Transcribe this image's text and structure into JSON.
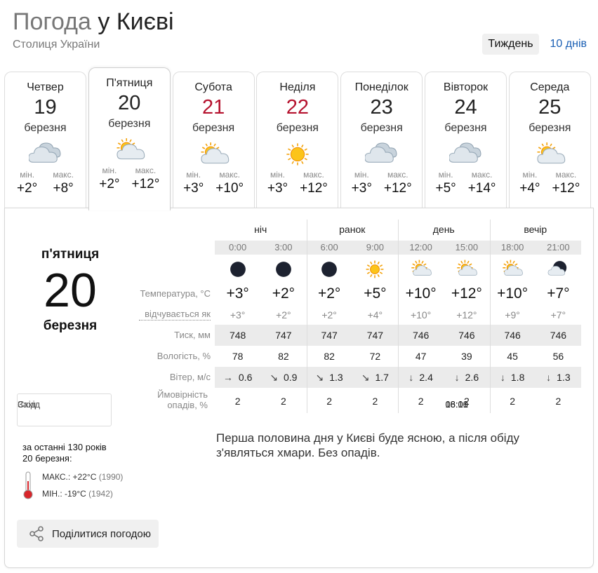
{
  "header": {
    "title_prefix": "Погода",
    "title_city": "у Києві",
    "subtitle": "Столиця України",
    "tabs": [
      {
        "label": "Тиждень",
        "active": true
      },
      {
        "label": "10 днів",
        "active": false
      }
    ]
  },
  "days": [
    {
      "name": "Четвер",
      "num": "19",
      "month": "березня",
      "weekend": false,
      "icon": "cloudy-icon",
      "min_label": "мін.",
      "max_label": "макс.",
      "min": "+2°",
      "max": "+8°"
    },
    {
      "name": "П'ятниця",
      "num": "20",
      "month": "березня",
      "weekend": false,
      "icon": "sun-cloud-icon",
      "min_label": "мін.",
      "max_label": "макс.",
      "min": "+2°",
      "max": "+12°",
      "active": true
    },
    {
      "name": "Субота",
      "num": "21",
      "month": "березня",
      "weekend": true,
      "icon": "sun-cloud-icon",
      "min_label": "мін.",
      "max_label": "макс.",
      "min": "+3°",
      "max": "+10°"
    },
    {
      "name": "Неділя",
      "num": "22",
      "month": "березня",
      "weekend": true,
      "icon": "sun-icon",
      "min_label": "мін.",
      "max_label": "макс.",
      "min": "+3°",
      "max": "+12°"
    },
    {
      "name": "Понеділок",
      "num": "23",
      "month": "березня",
      "weekend": false,
      "icon": "cloudy-icon",
      "min_label": "мін.",
      "max_label": "макс.",
      "min": "+3°",
      "max": "+12°"
    },
    {
      "name": "Вівторок",
      "num": "24",
      "month": "березня",
      "weekend": false,
      "icon": "cloudy-icon",
      "min_label": "мін.",
      "max_label": "макс.",
      "min": "+5°",
      "max": "+14°"
    },
    {
      "name": "Середа",
      "num": "25",
      "month": "березня",
      "weekend": false,
      "icon": "sun-cloud-icon",
      "min_label": "мін.",
      "max_label": "макс.",
      "min": "+4°",
      "max": "+12°"
    }
  ],
  "selected": {
    "weekday": "п'ятниця",
    "num": "20",
    "month": "березня",
    "sunrise_label": "Схід",
    "sunrise": "06:01",
    "sunset_label": "Захід",
    "sunset": "18:10"
  },
  "history": {
    "line1": "за останні 130 років",
    "line2": "20 березня:",
    "max_label": "МАКС.:",
    "max_value": "+22°C",
    "max_year": "(1990)",
    "min_label": "МІН.:",
    "min_value": "-19°C",
    "min_year": "(1942)"
  },
  "share_label": "Поділитися погодою",
  "periods": [
    "ніч",
    "ранок",
    "день",
    "вечір"
  ],
  "row_labels": {
    "temp": "Температура, °С",
    "feels": "відчувається як",
    "pressure": "Тиск, мм",
    "humidity": "Вологість, %",
    "wind": "Вітер, м/с",
    "precip": "Ймовірність опадів, %"
  },
  "hours": [
    {
      "time": "0:00",
      "icon": "moon-icon",
      "temp": "+3°",
      "feels": "+3°",
      "pressure": "748",
      "humidity": "78",
      "wind_dir": "→",
      "wind": "0.6",
      "precip": "2"
    },
    {
      "time": "3:00",
      "icon": "moon-icon",
      "temp": "+2°",
      "feels": "+2°",
      "pressure": "747",
      "humidity": "82",
      "wind_dir": "↘",
      "wind": "0.9",
      "precip": "2"
    },
    {
      "time": "6:00",
      "icon": "moon-icon",
      "temp": "+2°",
      "feels": "+2°",
      "pressure": "747",
      "humidity": "82",
      "wind_dir": "↘",
      "wind": "1.3",
      "precip": "2"
    },
    {
      "time": "9:00",
      "icon": "sun-icon",
      "temp": "+5°",
      "feels": "+4°",
      "pressure": "747",
      "humidity": "72",
      "wind_dir": "↘",
      "wind": "1.7",
      "precip": "2"
    },
    {
      "time": "12:00",
      "icon": "sun-cloud-icon",
      "temp": "+10°",
      "feels": "+10°",
      "pressure": "746",
      "humidity": "47",
      "wind_dir": "↓",
      "wind": "2.4",
      "precip": "2"
    },
    {
      "time": "15:00",
      "icon": "sun-cloud-icon",
      "temp": "+12°",
      "feels": "+12°",
      "pressure": "746",
      "humidity": "39",
      "wind_dir": "↓",
      "wind": "2.6",
      "precip": "2"
    },
    {
      "time": "18:00",
      "icon": "sun-cloud-icon",
      "temp": "+10°",
      "feels": "+9°",
      "pressure": "746",
      "humidity": "45",
      "wind_dir": "↓",
      "wind": "1.8",
      "precip": "2"
    },
    {
      "time": "21:00",
      "icon": "moon-cloud-icon",
      "temp": "+7°",
      "feels": "+7°",
      "pressure": "746",
      "humidity": "56",
      "wind_dir": "↓",
      "wind": "1.3",
      "precip": "2"
    }
  ],
  "description": "Перша половина дня у Києві буде ясною, а після обіду з'являться хмари. Без опадів.",
  "colors": {
    "weekend": "#b5122e",
    "link": "#1a5fb4",
    "shade": "#ebebeb"
  }
}
